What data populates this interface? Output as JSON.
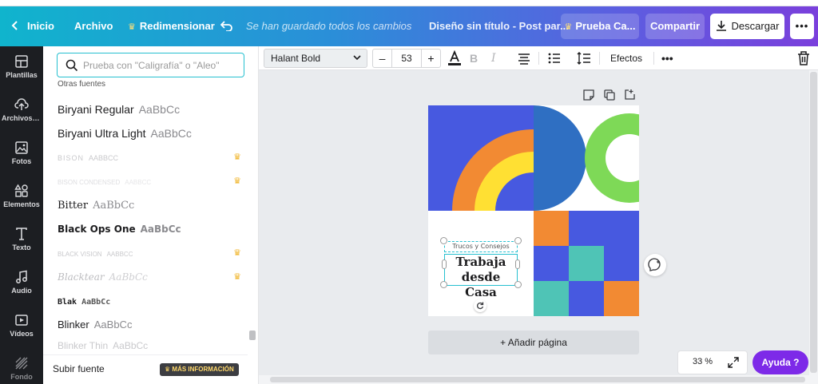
{
  "topbar": {
    "home": "Inicio",
    "file": "Archivo",
    "resize": "Redimensionar",
    "saved_status": "Se han guardado todos los cambios",
    "doc_title": "Diseño sin título - Post par...",
    "trial": "Prueba Ca...",
    "share": "Compartir",
    "download": "Descargar"
  },
  "rail": {
    "items": [
      {
        "label": "Plantillas",
        "icon": "templates-icon"
      },
      {
        "label": "Archivos s...",
        "icon": "upload-icon"
      },
      {
        "label": "Fotos",
        "icon": "photos-icon"
      },
      {
        "label": "Elementos",
        "icon": "elements-icon"
      },
      {
        "label": "Texto",
        "icon": "text-icon"
      },
      {
        "label": "Audio",
        "icon": "music-icon"
      },
      {
        "label": "Vídeos",
        "icon": "video-icon"
      },
      {
        "label": "Fondo",
        "icon": "background-icon"
      }
    ]
  },
  "panel": {
    "search_placeholder": "Prueba con \"Caligrafía\" o \"Aleo\"",
    "section": "Otras fuentes",
    "fonts": [
      {
        "name": "Biryani Regular",
        "sample": "AaBbCc",
        "premium": false
      },
      {
        "name": "Biryani Ultra Light",
        "sample": "AaBbCc",
        "premium": false
      },
      {
        "name": "BISON",
        "sample": "AABBCC",
        "premium": true
      },
      {
        "name": "BISON CONDENSED",
        "sample": "AABBCC",
        "premium": true
      },
      {
        "name": "Bitter",
        "sample": "AaBbCc",
        "premium": false
      },
      {
        "name": "Black Ops One",
        "sample": "AaBbCc",
        "premium": false
      },
      {
        "name": "BLACK VISION",
        "sample": "AABBCC",
        "premium": true
      },
      {
        "name": "Blacktear",
        "sample": "AaBbCc",
        "premium": true
      },
      {
        "name": "Blak",
        "sample": "AaBbCc",
        "premium": false
      },
      {
        "name": "Blinker",
        "sample": "AaBbCc",
        "premium": false
      },
      {
        "name": "Blinker Thin",
        "sample": "AaBbCc",
        "premium": false
      }
    ],
    "upload_font": "Subir fuente",
    "more_info": "MÁS INFORMACIÓN"
  },
  "toolbar": {
    "font_family": "Halant Bold",
    "font_size": "53",
    "minus": "–",
    "plus": "+",
    "effects": "Efectos"
  },
  "design": {
    "small_text": "Trucos y Consejos",
    "headline_1": "Trabaja",
    "headline_2": "desde Casa"
  },
  "canvas": {
    "add_page": "+ Añadir página",
    "zoom": "33 %",
    "help": "Ayuda ?"
  },
  "colors": {
    "accent": "#7d2ae8",
    "orange": "#f28a33",
    "blue": "#4759e0",
    "yellow": "#ffe033",
    "green": "#7ed957",
    "teal": "#4fc4b6",
    "dark_blue": "#2f6fc2"
  }
}
